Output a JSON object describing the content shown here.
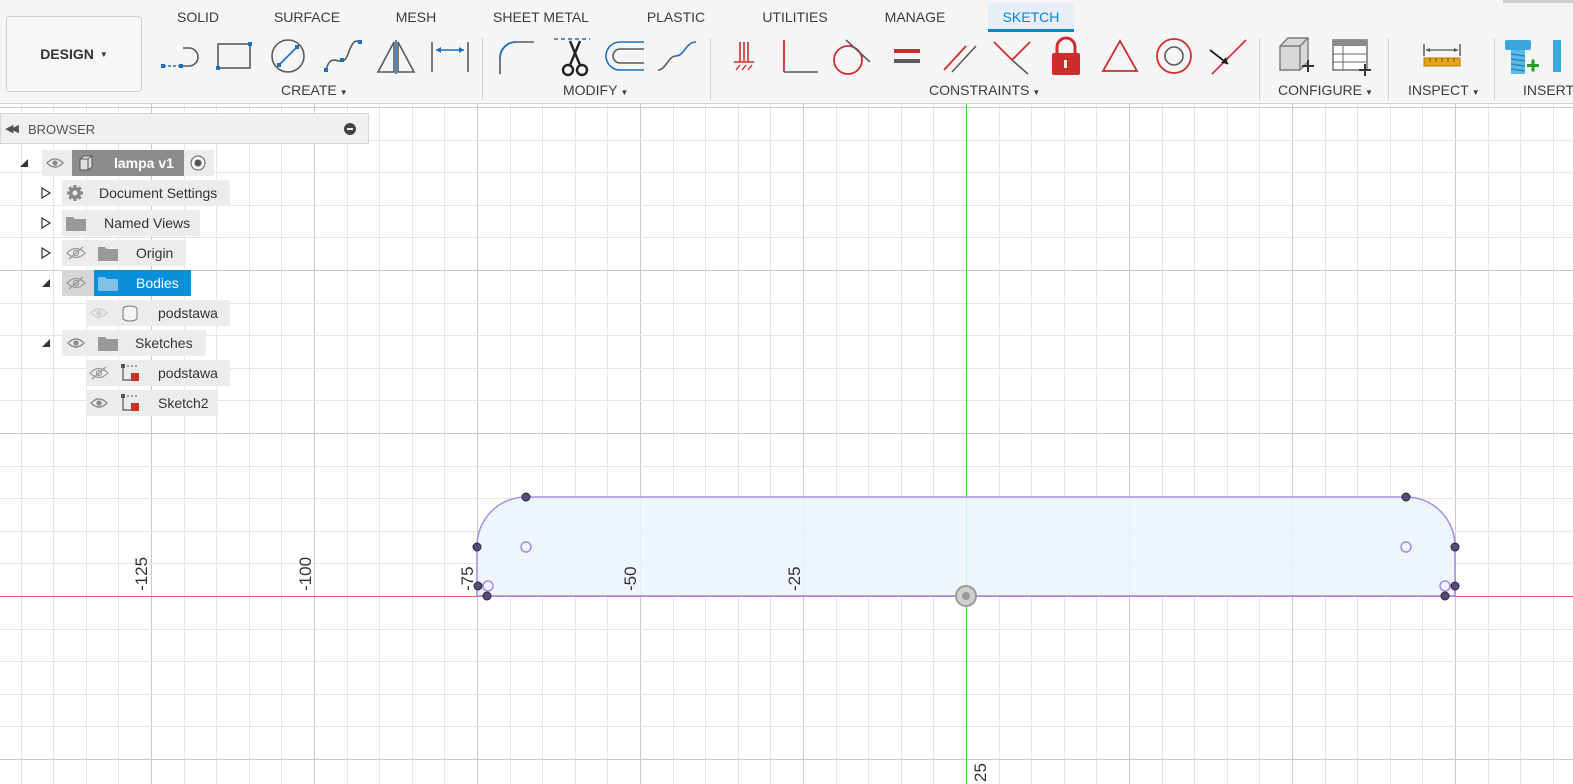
{
  "workspace": {
    "label": "DESIGN"
  },
  "tabs": [
    {
      "label": "SOLID",
      "active": false
    },
    {
      "label": "SURFACE",
      "active": false
    },
    {
      "label": "MESH",
      "active": false
    },
    {
      "label": "SHEET METAL",
      "active": false
    },
    {
      "label": "PLASTIC",
      "active": false
    },
    {
      "label": "UTILITIES",
      "active": false
    },
    {
      "label": "MANAGE",
      "active": false
    },
    {
      "label": "SKETCH",
      "active": true
    }
  ],
  "groups": {
    "create": "CREATE",
    "modify": "MODIFY",
    "constraints": "CONSTRAINTS",
    "configure": "CONFIGURE",
    "inspect": "INSPECT",
    "insert": "INSERT"
  },
  "tools": {
    "create": [
      "line-icon",
      "rectangle-icon",
      "circle-icon",
      "spline-icon",
      "mirror-icon",
      "sketch-dimension-icon"
    ],
    "modify": [
      "fillet-icon",
      "trim-icon",
      "offset-icon",
      "extend-icon"
    ],
    "constraints": [
      "fix-icon",
      "perpendicular-icon",
      "tangent-icon",
      "equal-icon",
      "parallel-icon",
      "coincident-icon",
      "lock-icon",
      "triangle-icon",
      "concentric-icon",
      "midpoint-icon"
    ],
    "configure": [
      "configure-body-icon",
      "configure-table-icon"
    ],
    "inspect": [
      "measure-icon"
    ],
    "insert": [
      "insert-bolt-icon"
    ]
  },
  "browser": {
    "title": "BROWSER",
    "nodes": [
      {
        "label": "lampa v1"
      },
      {
        "label": "Document Settings"
      },
      {
        "label": "Named Views"
      },
      {
        "label": "Origin"
      },
      {
        "label": "Bodies"
      },
      {
        "label": "podstawa"
      },
      {
        "label": "Sketches"
      },
      {
        "label": "podstawa"
      },
      {
        "label": "Sketch2"
      }
    ]
  },
  "axis_labels": [
    "-125",
    "-100",
    "-75",
    "-50",
    "-25",
    "25"
  ],
  "colors": {
    "accent": "#0a82cc",
    "selection": "#0a8fdc",
    "x_axis": "#e06666",
    "y_axis": "#43c943",
    "sketch_outline": "#a58ce6",
    "sketch_fill": "#ebf4fc",
    "sketch_point": "#5a4a78",
    "constraint_red": "#cc2e2e"
  }
}
